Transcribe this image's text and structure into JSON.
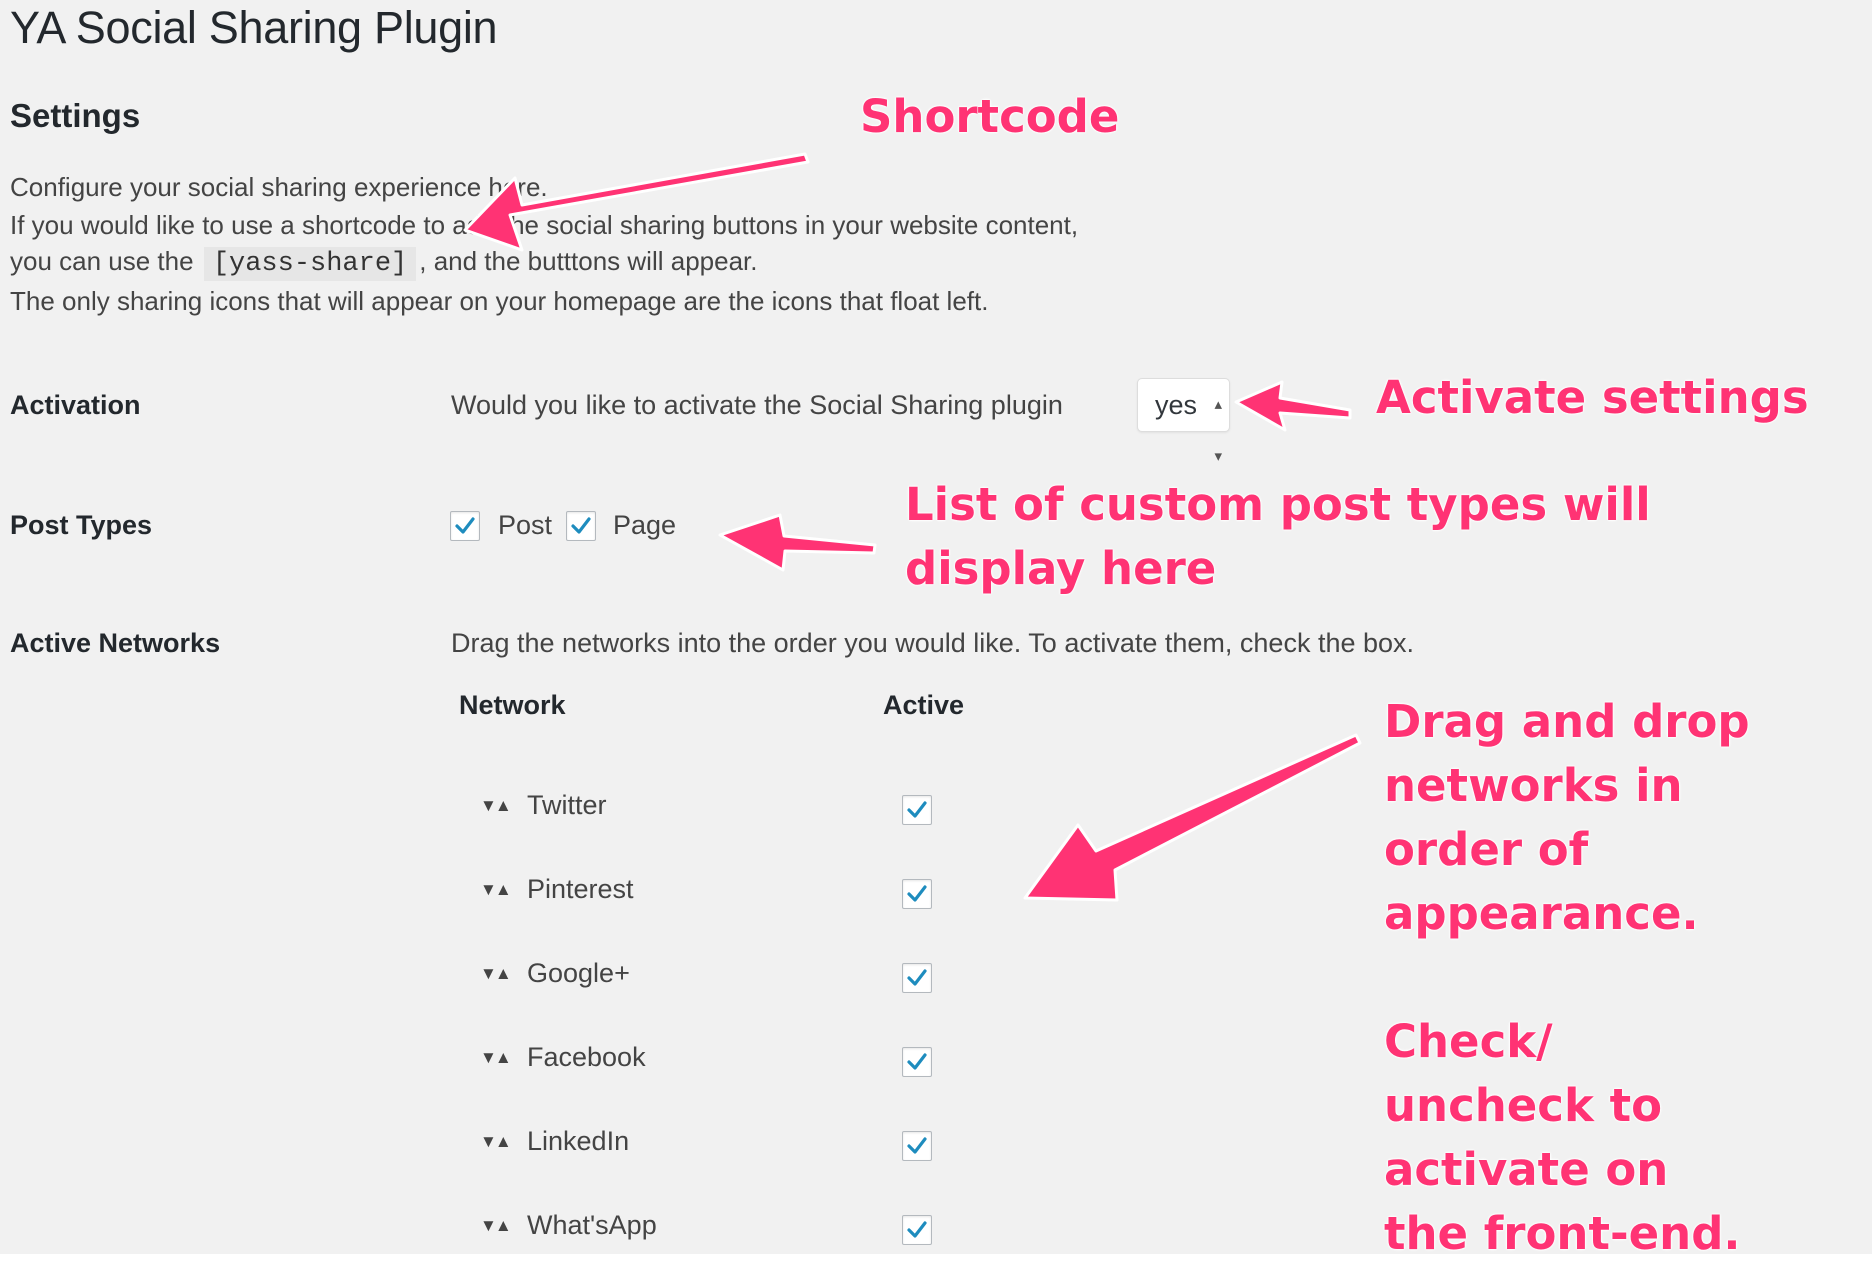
{
  "page_title": "YA Social Sharing Plugin",
  "section_title": "Settings",
  "intro": {
    "line1": "Configure your social sharing experience here.",
    "line2": "If you would like to use a shortcode to add the social sharing buttons in your website content,",
    "line3_before": "you can use the",
    "shortcode": "[yass-share]",
    "line3_after": ", and the butttons will appear.",
    "line4": "The only sharing icons that will appear on your homepage are the icons that float left."
  },
  "activation": {
    "label": "Activation",
    "question": "Would you like to activate the Social Sharing plugin",
    "selected": "yes"
  },
  "post_types": {
    "label": "Post Types",
    "items": [
      {
        "label": "Post",
        "checked": true
      },
      {
        "label": "Page",
        "checked": true
      }
    ]
  },
  "networks": {
    "label": "Active Networks",
    "description": "Drag the networks into the order you would like. To activate them, check the box.",
    "col_network": "Network",
    "col_active": "Active",
    "drag_glyph": "▼▲",
    "items": [
      {
        "name": "Twitter",
        "active": true
      },
      {
        "name": "Pinterest",
        "active": true
      },
      {
        "name": "Google+",
        "active": true
      },
      {
        "name": "Facebook",
        "active": true
      },
      {
        "name": "LinkedIn",
        "active": true
      },
      {
        "name": "What'sApp",
        "active": true
      }
    ]
  },
  "annotations": {
    "shortcode": "Shortcode",
    "activate": "Activate settings",
    "post_types_1": "List of custom post types will",
    "post_types_2": "display here",
    "drag_1": "Drag and drop",
    "drag_2": "networks in",
    "drag_3": "order of",
    "drag_4": "appearance.",
    "check_1": "Check/",
    "check_2": "uncheck to",
    "check_3": "activate on",
    "check_4": "the front-end."
  },
  "colors": {
    "annotation": "#ff3374",
    "background": "#f1f1f1",
    "checkmark": "#1e8cbe"
  }
}
